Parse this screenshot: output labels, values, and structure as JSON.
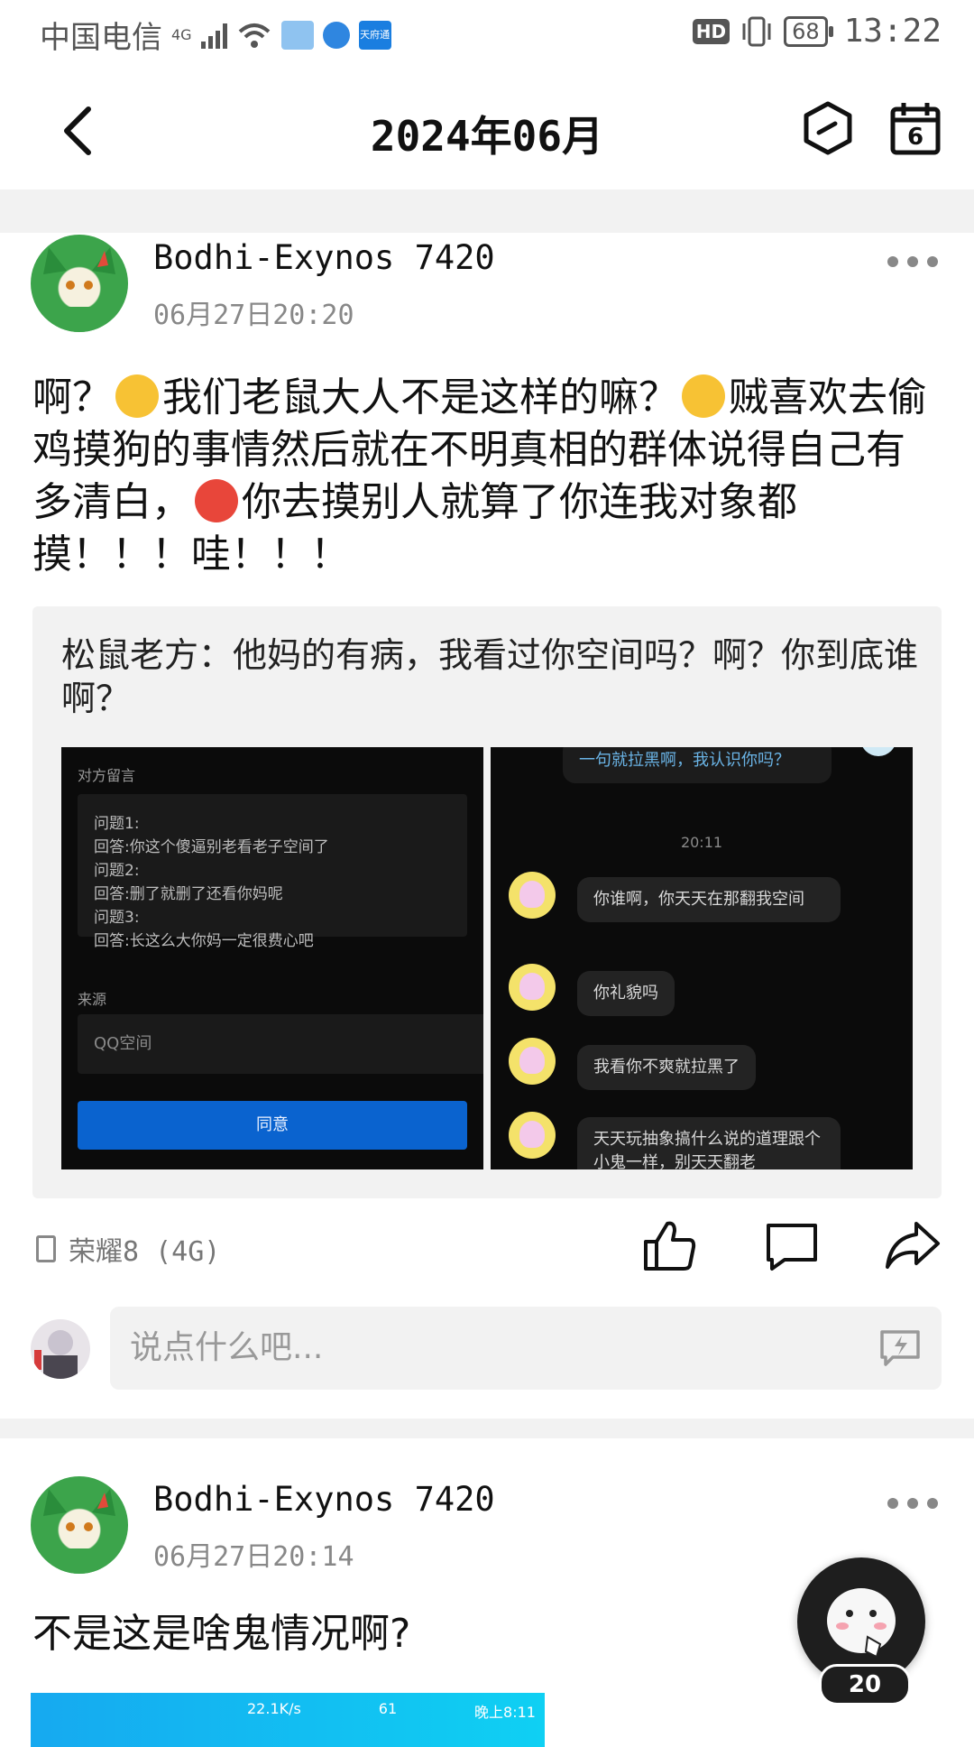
{
  "status_bar": {
    "carrier": "中国电信",
    "network": "4G",
    "battery": "68",
    "time": "13:22",
    "hd_label": "HD",
    "app_icon_label": "天府通"
  },
  "header": {
    "title": "2024年06月",
    "calendar_day": "6"
  },
  "posts": [
    {
      "author": "Bodhi-Exynos 7420",
      "time": "06月27日20:20",
      "text_parts": [
        "啊？",
        "我们老鼠大人不是这样的嘛？",
        "贼喜欢去偷鸡摸狗的事情然后就在不明真相的群体说得自己有多清白，",
        "你去摸别人就算了你连我对象都摸！！！哇！！！"
      ],
      "quote": {
        "text": "松鼠老方：他妈的有病，我看过你空间吗？啊？你到底谁啊？",
        "left_shot": {
          "header": "对方留言",
          "qa": [
            "问题1:",
            "回答:你这个傻逼别老看老子空间了",
            "问题2:",
            "回答:删了就删了还看你妈呢",
            "问题3:",
            "回答:长这么大你妈一定很费心吧"
          ],
          "source_label": "来源",
          "source_value": "QQ空间",
          "agree_button": "同意"
        },
        "right_shot": {
          "top_bubble": "一句就拉黑啊，我认识你吗？",
          "time": "20:11",
          "messages": [
            "你谁啊，你天天在那翻我空间",
            "你礼貌吗",
            "我看你不爽就拉黑了",
            "天天玩抽象搞什么说的道理跟个小鬼一样，别天天翻老"
          ]
        }
      },
      "device": "荣耀8 (4G)"
    },
    {
      "author": "Bodhi-Exynos 7420",
      "time": "06月27日20:14",
      "text": "不是这是啥鬼情况啊?",
      "thumb_status": {
        "speed": "22.1K/s",
        "clock": "晚上8:11",
        "battery": "61"
      }
    }
  ],
  "comment": {
    "placeholder": "说点什么吧..."
  },
  "fab": {
    "count": "20"
  },
  "colors": {
    "accent_blue": "#0a63cf",
    "divider": "#f2f2f2",
    "muted_text": "#888888"
  }
}
